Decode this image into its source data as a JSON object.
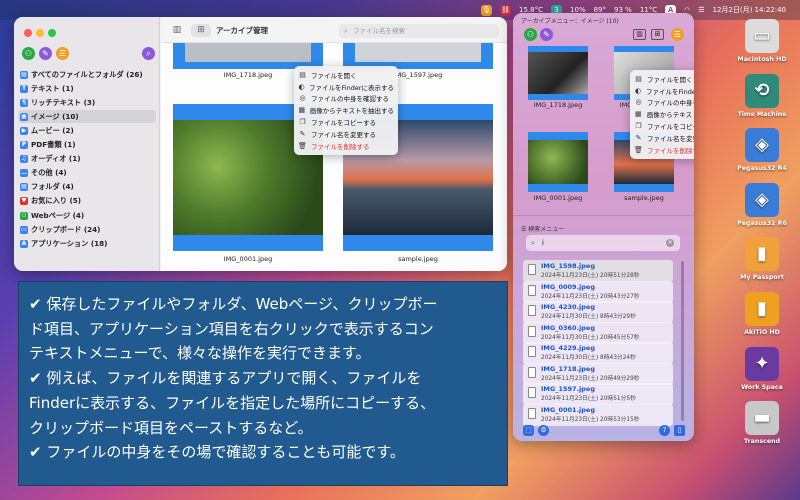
{
  "menubar": {
    "battery_level": "15.8°C",
    "badge_num": "3",
    "cpu": "10%",
    "mem": "89°",
    "battery": "93 %",
    "weather": "11°C",
    "input": "A",
    "datetime": "12月2日(月)  14:22:40"
  },
  "main_window": {
    "title": "アーカイブ管理",
    "search_placeholder": "ファイル名を検索",
    "sidebar": [
      {
        "label": "すべてのファイルとフォルダ (26)",
        "icon": "folder-icon",
        "color": "#3b82f6"
      },
      {
        "label": "テキスト (1)",
        "icon": "text-icon",
        "color": "#3b82f6"
      },
      {
        "label": "リッチテキスト (3)",
        "icon": "richtext-icon",
        "color": "#3b82f6"
      },
      {
        "label": "イメージ (10)",
        "icon": "image-icon",
        "color": "#3b82f6"
      },
      {
        "label": "ムービー (2)",
        "icon": "movie-icon",
        "color": "#3b82f6"
      },
      {
        "label": "PDF書類 (1)",
        "icon": "pdf-icon",
        "color": "#3b82f6"
      },
      {
        "label": "オーディオ (1)",
        "icon": "headphones-icon",
        "color": "#3b82f6"
      },
      {
        "label": "その他 (4)",
        "icon": "other-icon",
        "color": "#3b82f6"
      },
      {
        "label": "フォルダ (4)",
        "icon": "folder-icon",
        "color": "#3b82f6"
      },
      {
        "label": "お気に入り (5)",
        "icon": "heart-icon",
        "color": "#e0302a"
      },
      {
        "label": "Webページ (4)",
        "icon": "link-icon",
        "color": "#27a844"
      },
      {
        "label": "クリップボード (24)",
        "icon": "clipboard-icon",
        "color": "#3b82f6"
      },
      {
        "label": "アプリケーション (18)",
        "icon": "app-icon",
        "color": "#3b82f6"
      }
    ],
    "files": [
      {
        "name": "IMG_1718.jpeg"
      },
      {
        "name": "IMG_1597.jpeg"
      },
      {
        "name": "IMG_0001.jpeg"
      },
      {
        "name": "sample.jpeg"
      }
    ]
  },
  "context_menu": [
    {
      "label": "ファイルを開く",
      "icon": "open-icon"
    },
    {
      "label": "ファイルをFinderに表示する",
      "icon": "finder-icon"
    },
    {
      "label": "ファイルの中身を確認する",
      "icon": "preview-icon"
    },
    {
      "label": "画像からテキストを抽出する",
      "icon": "ocr-icon"
    },
    {
      "label": "ファイルをコピーする",
      "icon": "copy-icon"
    },
    {
      "label": "ファイル名を変更する",
      "icon": "rename-icon"
    },
    {
      "label": "ファイルを削除する",
      "icon": "trash-icon",
      "danger": true
    }
  ],
  "menu_window": {
    "title": "アーカイブメニュー：イメージ (10)",
    "files": [
      {
        "name": "IMG_1718.jpeg"
      },
      {
        "name": "IMG_1597.jpeg"
      },
      {
        "name": "IMG_0001.jpeg"
      },
      {
        "name": "sample.jpeg"
      }
    ],
    "search_label": "検索メニュー",
    "search_value": "i",
    "results": [
      {
        "name": "IMG_1598.jpeg",
        "date": "2024年11月23日(土) 20時51分28秒"
      },
      {
        "name": "IMG_0009.jpeg",
        "date": "2024年11月23日(土) 20時43分27秒"
      },
      {
        "name": "IMG_4230.jpeg",
        "date": "2024年11月30日(土) 8時43分29秒"
      },
      {
        "name": "IMG_0360.jpeg",
        "date": "2024年11月30日(土) 20時45分57秒"
      },
      {
        "name": "IMG_4229.jpeg",
        "date": "2024年11月30日(土) 8時43分24秒"
      },
      {
        "name": "IMG_1718.jpeg",
        "date": "2024年11月23日(土) 20時49分29秒"
      },
      {
        "name": "IMG_1597.jpeg",
        "date": "2024年11月23日(土) 20時51分5秒"
      },
      {
        "name": "IMG_0001.jpeg",
        "date": "2024年11月23日(土) 20時53分15秒"
      }
    ]
  },
  "caption": [
    "✔ 保存したファイルやフォルダ、Webページ、クリップボー",
    "ド項目、アプリケーション項目を右クリックで表示するコン",
    "テキストメニューで、様々な操作を実行できます。",
    "✔ 例えば、ファイルを関連するアプリで開く、ファイルを",
    "Finderに表示する、ファイルを指定した場所にコピーする、",
    "クリップボード項目をペーストするなど。",
    "✔ ファイルの中身をその場で確認することも可能です。"
  ],
  "desktop": [
    {
      "label": "Macintosh HD",
      "icon": "hard-drive-icon"
    },
    {
      "label": "Time Machine",
      "icon": "time-machine-icon"
    },
    {
      "label": "Pegasus32 R4",
      "icon": "raid-icon"
    },
    {
      "label": "Pegasus32 R6",
      "icon": "raid-icon"
    },
    {
      "label": "My Passport",
      "icon": "external-drive-icon"
    },
    {
      "label": "AkiTiO HD",
      "icon": "external-drive-icon"
    },
    {
      "label": "Work Space",
      "icon": "workspace-icon"
    },
    {
      "label": "Transcend",
      "icon": "usb-drive-icon"
    }
  ]
}
